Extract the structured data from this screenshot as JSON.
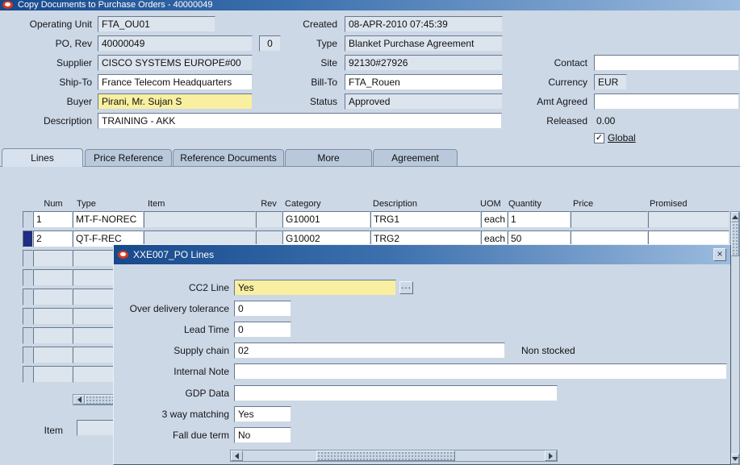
{
  "window": {
    "title": "Copy Documents to Purchase Orders - 40000049"
  },
  "colors": {
    "titlebar_dark": "#17498c",
    "titlebar_light": "#9cbbde",
    "oracle_red": "#d6391e",
    "required_field": "#f9efa0",
    "selected_record": "#1f2e80",
    "readonly_field": "#dce4ee"
  },
  "header": {
    "operating_unit": {
      "label": "Operating Unit",
      "value": "FTA_OU01"
    },
    "po_rev": {
      "label": "PO, Rev",
      "value": "40000049",
      "rev": "0"
    },
    "supplier": {
      "label": "Supplier",
      "value": "CISCO SYSTEMS EUROPE#00"
    },
    "ship_to": {
      "label": "Ship-To",
      "value": "France Telecom Headquarters"
    },
    "buyer": {
      "label": "Buyer",
      "value": "Pirani, Mr. Sujan S"
    },
    "description": {
      "label": "Description",
      "value": "TRAINING - AKK"
    },
    "created": {
      "label": "Created",
      "value": "08-APR-2010 07:45:39"
    },
    "doc_type": {
      "label": "Type",
      "value": "Blanket Purchase Agreement"
    },
    "site": {
      "label": "Site",
      "value": "92130#27926"
    },
    "bill_to": {
      "label": "Bill-To",
      "value": "FTA_Rouen"
    },
    "status": {
      "label": "Status",
      "value": "Approved"
    },
    "contact": {
      "label": "Contact",
      "value": ""
    },
    "currency": {
      "label": "Currency",
      "value": "EUR"
    },
    "amt_agreed": {
      "label": "Amt Agreed",
      "value": ""
    },
    "released": {
      "label": "Released",
      "value": "0.00"
    },
    "global_check": {
      "label": "Global",
      "checked": true,
      "mark": "✓"
    }
  },
  "tabs": [
    {
      "label": "Lines",
      "active": true
    },
    {
      "label": "Price Reference",
      "active": false
    },
    {
      "label": "Reference Documents",
      "active": false
    },
    {
      "label": "More",
      "active": false
    },
    {
      "label": "Agreement",
      "active": false
    }
  ],
  "lines": {
    "columns": {
      "num": "Num",
      "type": "Type",
      "item": "Item",
      "rev": "Rev",
      "category": "Category",
      "description": "Description",
      "uom": "UOM",
      "quantity": "Quantity",
      "price": "Price",
      "promised": "Promised"
    },
    "rows": [
      {
        "num": "1",
        "type": "MT-F-NOREC",
        "item": "",
        "rev": "",
        "category": "G10001",
        "description": "TRG1",
        "uom": "each",
        "quantity": "1",
        "price": "",
        "promised": "",
        "selected": false
      },
      {
        "num": "2",
        "type": "QT-F-REC",
        "item": "",
        "rev": "",
        "category": "G10002",
        "description": "TRG2",
        "uom": "each",
        "quantity": "50",
        "price": "",
        "promised": "",
        "selected": true
      }
    ],
    "footer_item_label": "Item"
  },
  "dialog": {
    "title": "XXE007_PO Lines",
    "close_glyph": "×",
    "lov_glyph": "...",
    "fields": [
      {
        "label": "CC2 Line",
        "value": "Yes"
      },
      {
        "label": "Over delivery tolerance",
        "value": "0"
      },
      {
        "label": "Lead Time",
        "value": "0"
      },
      {
        "label": "Supply chain",
        "value": "02",
        "note": "Non stocked"
      },
      {
        "label": "Internal Note",
        "value": ""
      },
      {
        "label": "GDP Data",
        "value": ""
      },
      {
        "label": "3 way matching",
        "value": "Yes"
      },
      {
        "label": "Fall due term",
        "value": "No"
      }
    ]
  }
}
